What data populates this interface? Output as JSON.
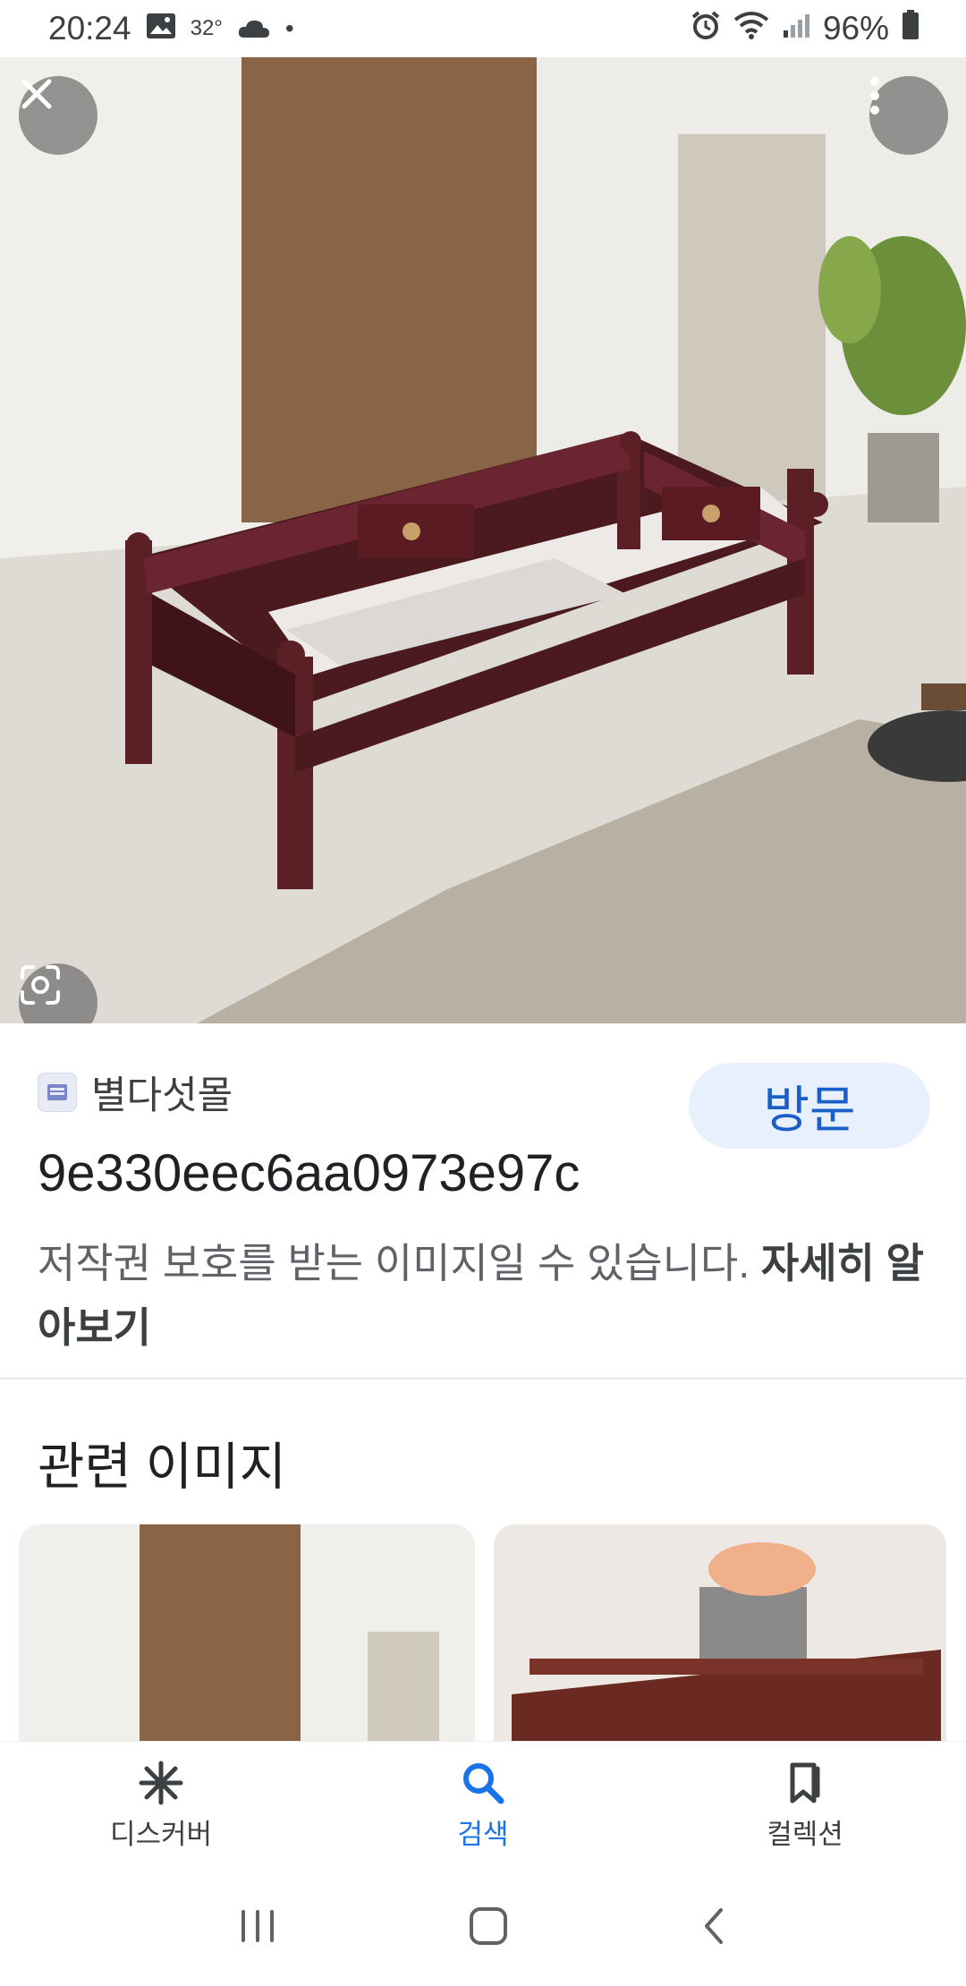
{
  "status_bar": {
    "time": "20:24",
    "temperature": "32°",
    "dot": "•",
    "battery": "96%"
  },
  "hero": {
    "icons": [
      "close-icon",
      "more-vert-icon",
      "lens-icon"
    ]
  },
  "result": {
    "source_name": "별다섯몰",
    "visit_label": "방문",
    "title": "9e330eec6aa0973e97c",
    "copyright_notice": "저작권 보호를 받는 이미지일 수 있습니다.",
    "learn_more": "자세히 알아보기"
  },
  "related": {
    "heading": "관련 이미지"
  },
  "bottom_nav": {
    "items": [
      {
        "label": "디스커버",
        "icon": "discover-icon"
      },
      {
        "label": "검색",
        "icon": "search-icon"
      },
      {
        "label": "컬렉션",
        "icon": "collections-icon"
      }
    ],
    "active_color": "#1a73e8"
  },
  "system_nav": {
    "icons": [
      "recents-icon",
      "home-icon",
      "back-icon"
    ]
  }
}
